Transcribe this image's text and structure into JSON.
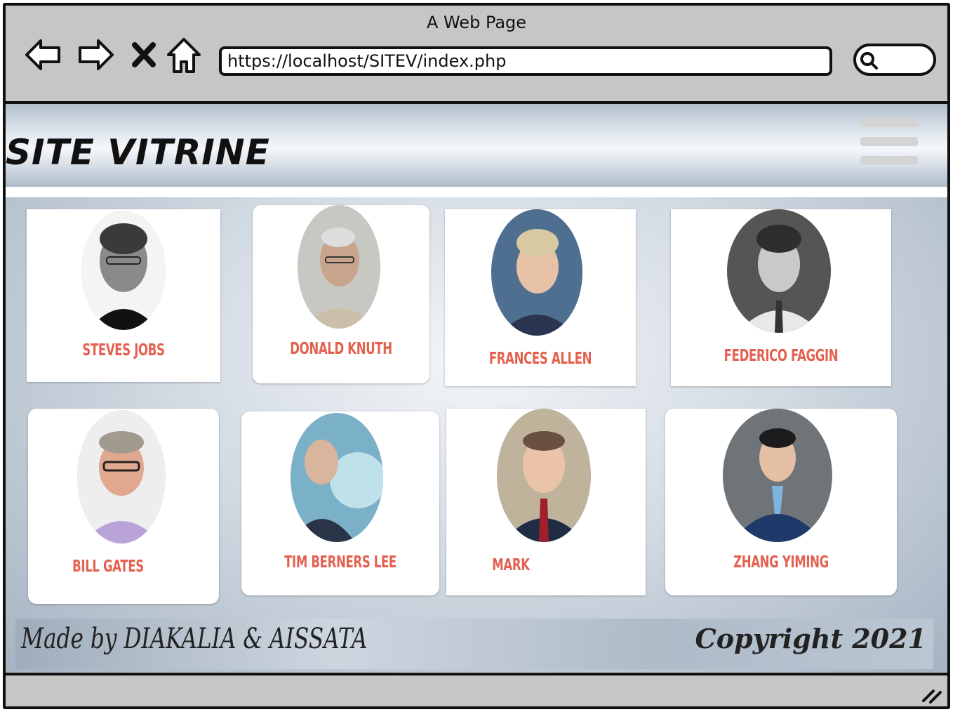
{
  "window": {
    "title": "A Web Page"
  },
  "browser": {
    "url": "https://localhost/SITEV/index.php"
  },
  "site": {
    "title": "SITE VITRINE"
  },
  "cards": [
    {
      "name": "STEVES JOBS"
    },
    {
      "name": "DONALD KNUTH"
    },
    {
      "name": "FRANCES ALLEN"
    },
    {
      "name": "FEDERICO FAGGIN"
    },
    {
      "name": "BILL GATES"
    },
    {
      "name": "TIM BERNERS LEE"
    },
    {
      "name": "MARK"
    },
    {
      "name": "ZHANG YIMING"
    }
  ],
  "footer": {
    "credits": "Made by DIAKALIA & AISSATA",
    "copyright": "Copyright 2021"
  },
  "colors": {
    "accent": "#e46150",
    "chrome": "#c6c6c6"
  },
  "icons": [
    "back-arrow-icon",
    "forward-arrow-icon",
    "stop-icon",
    "home-icon",
    "search-icon",
    "hamburger-menu-icon",
    "resize-grip-icon"
  ]
}
